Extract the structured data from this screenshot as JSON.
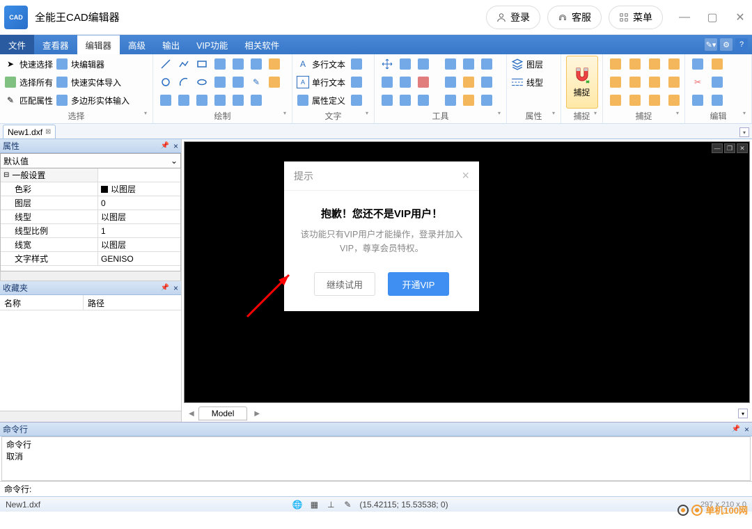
{
  "app": {
    "title": "全能王CAD编辑器",
    "logo_text": "CAD"
  },
  "title_buttons": {
    "login": "登录",
    "cs": "客服",
    "menu": "菜单"
  },
  "menu": {
    "file": "文件",
    "tabs": [
      "查看器",
      "编辑器",
      "高级",
      "输出",
      "VIP功能",
      "相关软件"
    ],
    "active_index": 1
  },
  "ribbon": {
    "select": {
      "quick": "快速选择",
      "all": "选择所有",
      "match": "匹配属性",
      "blockedit": "块编辑器",
      "quickent": "快速实体导入",
      "poly": "多边形实体输入",
      "label": "选择"
    },
    "draw_label": "绘制",
    "text": {
      "mtext": "多行文本",
      "stext": "单行文本",
      "attdef": "属性定义",
      "label": "文字"
    },
    "tools_label": "工具",
    "props": {
      "layer": "图层",
      "ltype": "线型",
      "label": "属性"
    },
    "snap": "捕捉",
    "snap_label": "捕捉",
    "edit_label": "编辑"
  },
  "doctab": "New1.dxf",
  "props_panel": {
    "title": "属性",
    "default": "默认值",
    "group": "一般设置",
    "rows": [
      {
        "k": "色彩",
        "v": "以图层",
        "swatch": true
      },
      {
        "k": "图层",
        "v": "0"
      },
      {
        "k": "线型",
        "v": "以图层"
      },
      {
        "k": "线型比例",
        "v": "1"
      },
      {
        "k": "线宽",
        "v": "以图层"
      },
      {
        "k": "文字样式",
        "v": "GENISO"
      }
    ]
  },
  "fav": {
    "title": "收藏夹",
    "name": "名称",
    "path": "路径"
  },
  "model_tab": "Model",
  "cmd": {
    "title": "命令行",
    "lines": [
      "命令行",
      "取消"
    ],
    "prompt": "命令行:"
  },
  "status": {
    "file": "New1.dxf",
    "coords": "(15.42115; 15.53538; 0)",
    "dims": "297 x 210 x 0"
  },
  "dialog": {
    "title": "提示",
    "h": "抱歉！您还不是VIP用户！",
    "p": "该功能只有VIP用户才能操作，登录并加入VIP，尊享会员特权。",
    "cont": "继续试用",
    "vip": "开通VIP"
  },
  "watermark": "单机100网"
}
